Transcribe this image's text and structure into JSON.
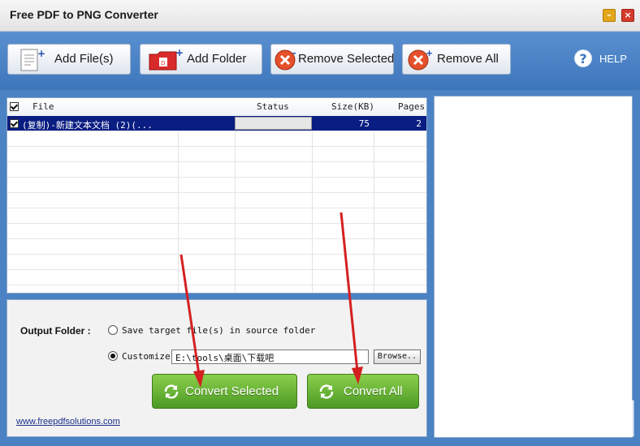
{
  "window": {
    "title": "Free PDF to PNG Converter",
    "minimize": "–",
    "close": "×"
  },
  "toolbar": {
    "add_files": "Add File(s)",
    "add_folder": "Add Folder",
    "remove_selected": "Remove Selected",
    "remove_all": "Remove All",
    "help": "HELP"
  },
  "file_list": {
    "columns": {
      "file": "File",
      "status": "Status",
      "size": "Size(KB)",
      "pages": "Pages"
    },
    "rows": [
      {
        "file": "(复制)-新建文本文档 (2)(...",
        "status": "",
        "size": "75",
        "pages": "2"
      }
    ]
  },
  "output": {
    "label": "Output Folder :",
    "option_source": "Save target file(s) in source folder",
    "option_customize": "Customize",
    "path": "E:\\tools\\桌面\\下载吧",
    "browse": "Browse..",
    "selected_option": "customize"
  },
  "actions": {
    "convert_selected": "Convert Selected",
    "convert_all": "Convert All"
  },
  "footer": {
    "website": "www.freepdfsolutions.com"
  },
  "colors": {
    "toolbar": "#4a82c4",
    "selected_row": "#0a1d82",
    "green_button": "#5fae2e",
    "arrow": "#d42020"
  }
}
